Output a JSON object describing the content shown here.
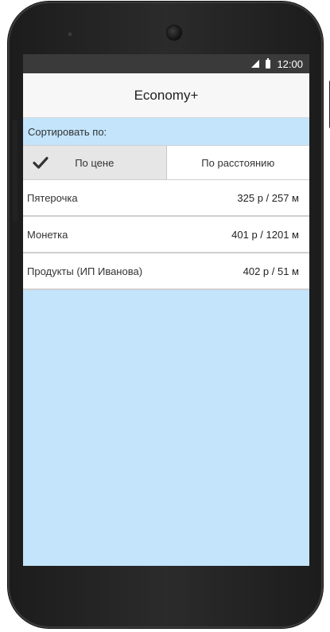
{
  "status_bar": {
    "time": "12:00"
  },
  "header": {
    "title": "Economy+"
  },
  "sort": {
    "label": "Сортировать по:",
    "options": [
      {
        "label": "По цене",
        "selected": true
      },
      {
        "label": "По расстоянию",
        "selected": false
      }
    ]
  },
  "stores": [
    {
      "name": "Пятерочка",
      "info": "325 р / 257 м"
    },
    {
      "name": "Монетка",
      "info": "401 р / 1201 м"
    },
    {
      "name": "Продукты (ИП Иванова)",
      "info": "402 р / 51 м"
    }
  ],
  "colors": {
    "screen_background": "#c3e4fb",
    "header_background": "#f7f7f7",
    "status_bar": "#3a3a3a"
  },
  "icons": [
    "signal-icon",
    "battery-icon",
    "check-icon"
  ]
}
